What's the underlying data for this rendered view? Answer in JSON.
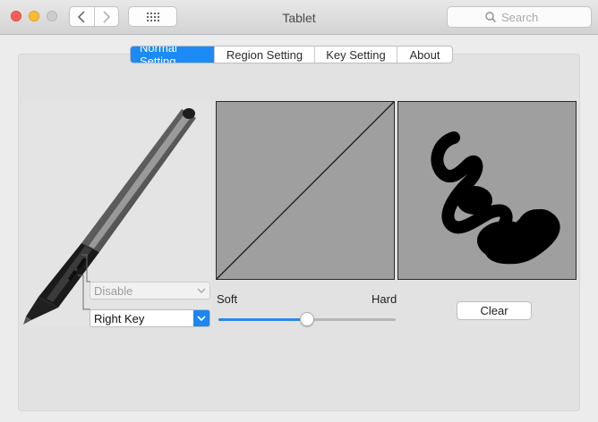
{
  "window": {
    "title": "Tablet"
  },
  "toolbar": {
    "search_placeholder": "Search"
  },
  "tabs": [
    {
      "label": "Normal Setting",
      "active": true
    },
    {
      "label": "Region Setting",
      "active": false
    },
    {
      "label": "Key Setting",
      "active": false
    },
    {
      "label": "About",
      "active": false
    }
  ],
  "pen": {
    "upper_key": {
      "value": "Disable",
      "disabled": true
    },
    "lower_key": {
      "value": "Right Key",
      "disabled": false
    }
  },
  "pressure": {
    "soft_label": "Soft",
    "hard_label": "Hard",
    "slider_value": 0.5
  },
  "drawpad": {
    "clear_label": "Clear"
  },
  "colors": {
    "accent": "#1c8bf5",
    "graph_bg": "#9f9f9f",
    "panel_bg": "#e2e2e2"
  }
}
